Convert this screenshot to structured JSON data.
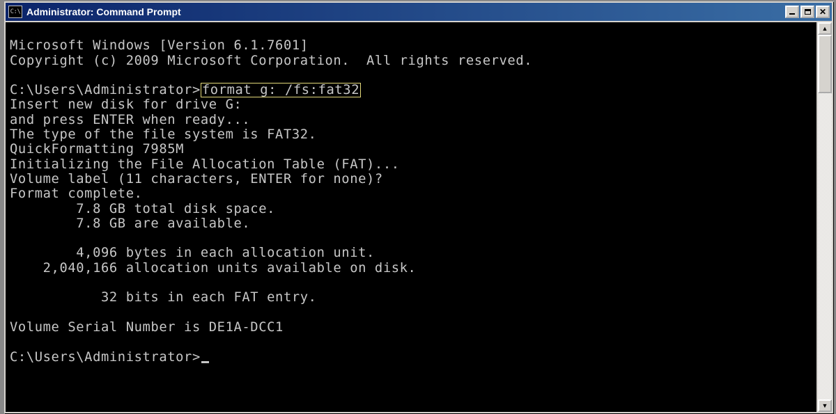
{
  "window": {
    "title": "Administrator: Command Prompt",
    "icon_label": "C:\\",
    "buttons": {
      "min": "minimize",
      "max": "maximize",
      "close": "close"
    }
  },
  "scroll": {
    "thumb_top_pct": 0,
    "thumb_height_pct": 16
  },
  "prompts": {
    "prompt1": "C:\\Users\\Administrator>",
    "command1": "format g: /fs:fat32",
    "prompt2": "C:\\Users\\Administrator>"
  },
  "lines": {
    "l1": "Microsoft Windows [Version 6.1.7601]",
    "l2": "Copyright (c) 2009 Microsoft Corporation.  All rights reserved.",
    "l3": "",
    "l5": "Insert new disk for drive G:",
    "l6": "and press ENTER when ready...",
    "l7": "The type of the file system is FAT32.",
    "l8": "QuickFormatting 7985M",
    "l9": "Initializing the File Allocation Table (FAT)...",
    "l10": "Volume label (11 characters, ENTER for none)?",
    "l11": "Format complete.",
    "l12": "        7.8 GB total disk space.",
    "l13": "        7.8 GB are available.",
    "l14": "",
    "l15": "        4,096 bytes in each allocation unit.",
    "l16": "    2,040,166 allocation units available on disk.",
    "l17": "",
    "l18": "           32 bits in each FAT entry.",
    "l19": "",
    "l20": "Volume Serial Number is DE1A-DCC1",
    "l21": ""
  }
}
